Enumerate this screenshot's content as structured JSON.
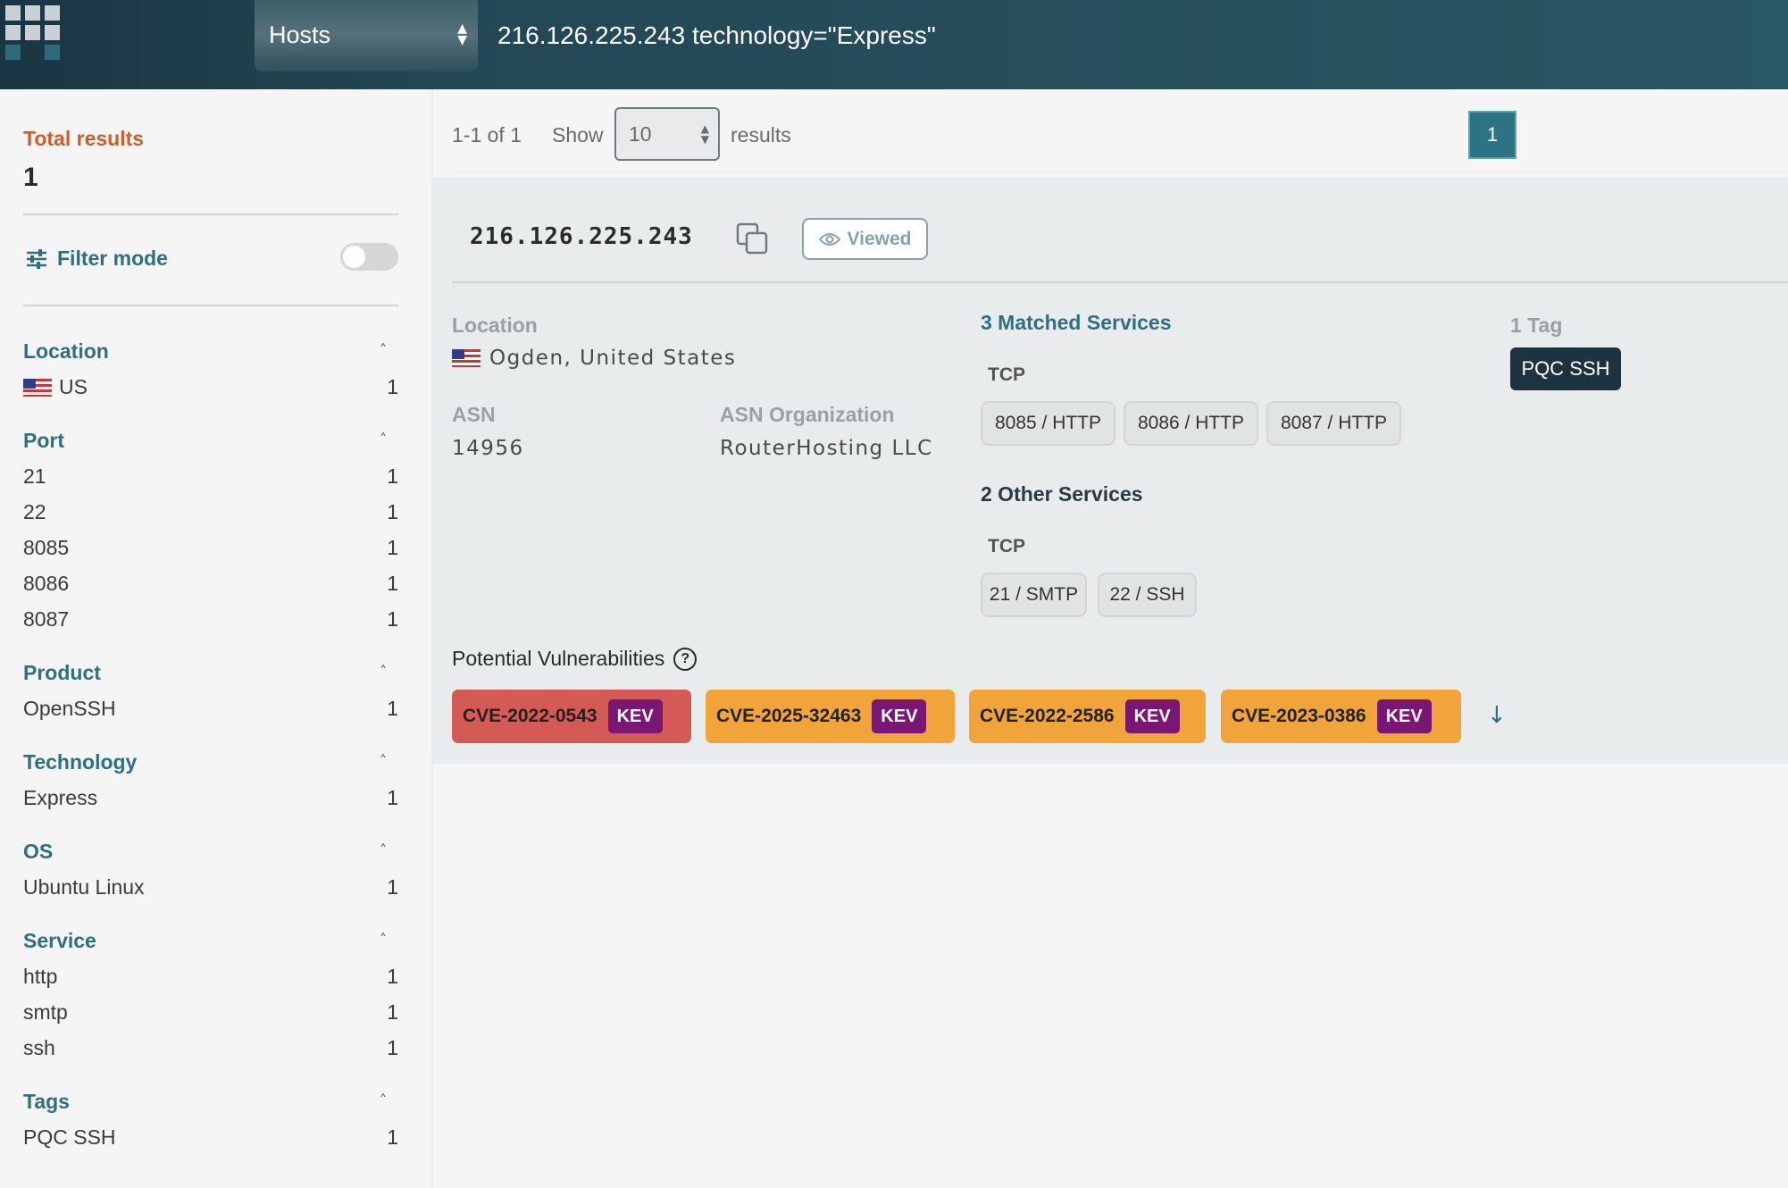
{
  "header": {
    "type_select": "Hosts",
    "query": "216.126.225.243 technology=\"Express\""
  },
  "sidebar": {
    "total_label": "Total results",
    "total_value": "1",
    "filter_mode_label": "Filter mode",
    "filter_mode_on": false,
    "facets": [
      {
        "title": "Location",
        "items": [
          {
            "label": "US",
            "count": "1",
            "flag": "us"
          }
        ]
      },
      {
        "title": "Port",
        "items": [
          {
            "label": "21",
            "count": "1"
          },
          {
            "label": "22",
            "count": "1"
          },
          {
            "label": "8085",
            "count": "1"
          },
          {
            "label": "8086",
            "count": "1"
          },
          {
            "label": "8087",
            "count": "1"
          }
        ]
      },
      {
        "title": "Product",
        "items": [
          {
            "label": "OpenSSH",
            "count": "1"
          }
        ]
      },
      {
        "title": "Technology",
        "items": [
          {
            "label": "Express",
            "count": "1"
          }
        ]
      },
      {
        "title": "OS",
        "items": [
          {
            "label": "Ubuntu Linux",
            "count": "1"
          }
        ]
      },
      {
        "title": "Service",
        "items": [
          {
            "label": "http",
            "count": "1"
          },
          {
            "label": "smtp",
            "count": "1"
          },
          {
            "label": "ssh",
            "count": "1"
          }
        ]
      },
      {
        "title": "Tags",
        "items": [
          {
            "label": "PQC SSH",
            "count": "1"
          }
        ]
      }
    ]
  },
  "pager": {
    "range": "1-1 of 1",
    "show_label": "Show",
    "show_value": "10",
    "results_label": "results",
    "current_page": "1"
  },
  "result": {
    "ip": "216.126.225.243",
    "viewed_label": "Viewed",
    "location_label": "Location",
    "location_value": "Ogden, United States",
    "asn_label": "ASN",
    "asn_value": "14956",
    "asn_org_label": "ASN Organization",
    "asn_org_value": "RouterHosting LLC",
    "matched_services_title": "3 Matched Services",
    "matched_protocol": "TCP",
    "matched_services": [
      "8085 / HTTP",
      "8086 / HTTP",
      "8087 / HTTP"
    ],
    "other_services_title": "2 Other Services",
    "other_protocol": "TCP",
    "other_services": [
      "21 / SMTP",
      "22 / SSH"
    ],
    "tags_title": "1 Tag",
    "tags": [
      "PQC SSH"
    ],
    "vulns_title": "Potential Vulnerabilities",
    "vulns": [
      {
        "id": "CVE-2022-0543",
        "badge": "KEV",
        "color": "#d45b55"
      },
      {
        "id": "CVE-2025-32463",
        "badge": "KEV",
        "color": "#f0a43a"
      },
      {
        "id": "CVE-2022-2586",
        "badge": "KEV",
        "color": "#f0a43a"
      },
      {
        "id": "CVE-2023-0386",
        "badge": "KEV",
        "color": "#f0a43a"
      }
    ]
  },
  "colors": {
    "accent": "#2f6f80",
    "total_label": "#c95f2c",
    "kev_badge": "#7a1673",
    "tag_dark": "#1d3340"
  }
}
